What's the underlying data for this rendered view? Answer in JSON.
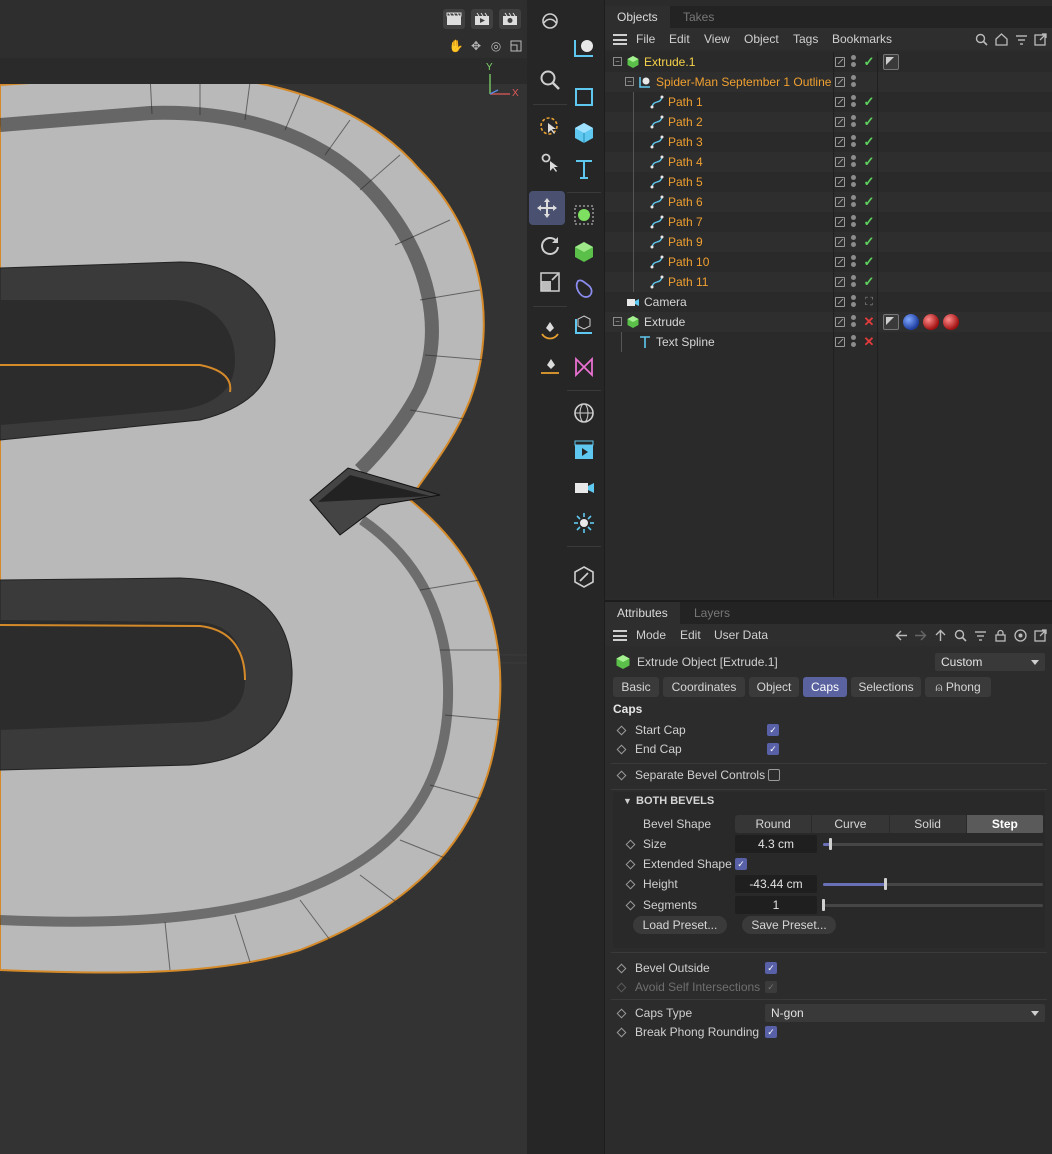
{
  "objects_panel": {
    "tabs": [
      "Objects",
      "Takes"
    ],
    "menu": [
      "File",
      "Edit",
      "View",
      "Object",
      "Tags",
      "Bookmarks"
    ],
    "tree": [
      {
        "name": "Extrude.1",
        "level": 0,
        "color": "yellow",
        "icon": "extrude-icon",
        "expander": "−",
        "state": "check",
        "tags": [
          "phong-tag"
        ]
      },
      {
        "name": "Spider-Man September 1 Outline",
        "level": 1,
        "color": "orange",
        "icon": "connect-icon",
        "expander": "−",
        "state": ""
      },
      {
        "name": "Path 1",
        "level": 2,
        "color": "orange",
        "icon": "spline-icon",
        "state": "check"
      },
      {
        "name": "Path 2",
        "level": 2,
        "color": "orange",
        "icon": "spline-icon",
        "state": "check"
      },
      {
        "name": "Path 3",
        "level": 2,
        "color": "orange",
        "icon": "spline-icon",
        "state": "check"
      },
      {
        "name": "Path 4",
        "level": 2,
        "color": "orange",
        "icon": "spline-icon",
        "state": "check"
      },
      {
        "name": "Path 5",
        "level": 2,
        "color": "orange",
        "icon": "spline-icon",
        "state": "check"
      },
      {
        "name": "Path 6",
        "level": 2,
        "color": "orange",
        "icon": "spline-icon",
        "state": "check"
      },
      {
        "name": "Path 7",
        "level": 2,
        "color": "orange",
        "icon": "spline-icon",
        "state": "check"
      },
      {
        "name": "Path 9",
        "level": 2,
        "color": "orange",
        "icon": "spline-icon",
        "state": "check"
      },
      {
        "name": "Path 10",
        "level": 2,
        "color": "orange",
        "icon": "spline-icon",
        "state": "check"
      },
      {
        "name": "Path 11",
        "level": 2,
        "color": "orange",
        "icon": "spline-icon",
        "state": "check"
      },
      {
        "name": "Camera",
        "level": 0,
        "color": "white",
        "icon": "camera-icon",
        "state": "target"
      },
      {
        "name": "Extrude",
        "level": 0,
        "color": "white",
        "icon": "extrude-icon",
        "expander": "−",
        "state": "cross",
        "tags": [
          "phong-tag",
          "material-blue",
          "material-red",
          "material-red"
        ]
      },
      {
        "name": "Text Spline",
        "level": 1,
        "color": "white",
        "icon": "text-icon",
        "state": "cross"
      }
    ]
  },
  "attributes_panel": {
    "tabs": [
      "Attributes",
      "Layers"
    ],
    "menu": [
      "Mode",
      "Edit",
      "User Data"
    ],
    "object_title": "Extrude Object [Extrude.1]",
    "preset_dropdown": "Custom",
    "sub_tabs": [
      "Basic",
      "Coordinates",
      "Object",
      "Caps",
      "Selections",
      "Phong"
    ],
    "active_sub_tab": "Caps",
    "section_title": "Caps",
    "start_cap": "Start Cap",
    "end_cap": "End Cap",
    "separate_bevel": "Separate Bevel Controls",
    "both_bevels": "BOTH BEVELS",
    "bevel_shape_label": "Bevel Shape",
    "bevel_shapes": [
      "Round",
      "Curve",
      "Solid",
      "Step"
    ],
    "bevel_shape_active": "Step",
    "size_label": "Size",
    "size_value": "4.3 cm",
    "size_fraction": 0.03,
    "extended_shape": "Extended Shape",
    "height_label": "Height",
    "height_value": "-43.44 cm",
    "height_fraction": 0.28,
    "segments_label": "Segments",
    "segments_value": "1",
    "segments_fraction": 0.0,
    "load_preset": "Load Preset...",
    "save_preset": "Save Preset...",
    "bevel_outside": "Bevel Outside",
    "avoid_self": "Avoid Self Intersections",
    "caps_type_label": "Caps Type",
    "caps_type_value": "N-gon",
    "break_phong": "Break Phong Rounding"
  },
  "viewport": {
    "axis_y": "Y",
    "axis_x": "X"
  },
  "colors": {
    "accent": "#5a62a0",
    "check": "#5fd35f",
    "cross": "#e23b3b",
    "object_orange": "#f0a030",
    "object_yellow": "#f6d24a",
    "tool_cyan": "#5fc8f0",
    "tool_green": "#7ee060"
  }
}
